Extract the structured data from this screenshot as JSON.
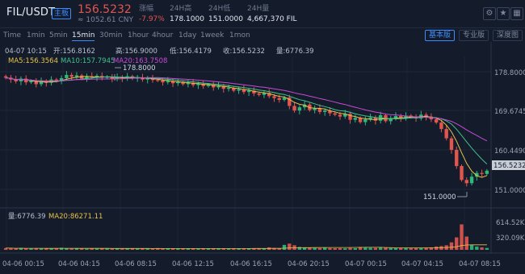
{
  "header": {
    "pair": "FIL/USDT",
    "board_tag": "主板",
    "last_price": "156.5232",
    "cny_price": "≈ 1052.61 CNY",
    "stats": [
      {
        "label": "涨幅",
        "value": "-7.97%",
        "red": true
      },
      {
        "label": "24H高",
        "value": "178.1000",
        "red": false
      },
      {
        "label": "24H低",
        "value": "151.0000",
        "red": false
      },
      {
        "label": "24H量",
        "value": "4,667,370 FIL",
        "red": false
      }
    ],
    "icons": [
      "gear-icon",
      "star-icon",
      "grid-icon"
    ]
  },
  "toolbar": {
    "intervals": [
      "Time",
      "1min",
      "5min",
      "15min",
      "30min",
      "1hour",
      "4hour",
      "1day",
      "1week",
      "1mon"
    ],
    "active_interval": "15min",
    "modes": [
      "基本版",
      "专业版",
      "深度图"
    ],
    "active_mode": "基本版"
  },
  "ohlc": {
    "date": "04-07 10:15",
    "open": "开:156.8162",
    "high": "高:156.9000",
    "low": "低:156.4179",
    "close": "收:156.5232",
    "amount": "量:6776.39"
  },
  "ma_legend": {
    "ma5": "MA5:156.3564",
    "ma10": "MA10:157.7945",
    "ma20": "MA20:163.7508"
  },
  "volume_legend": {
    "vol": "量:6776.39",
    "ma20": "MA20:86271.11"
  },
  "annotations": {
    "high_marker": "178.8000",
    "low_marker": "151.0000"
  },
  "colors": {
    "up": "#2fb87a",
    "down": "#e0564f",
    "ma5": "#e6c34a",
    "ma10": "#3fc28c",
    "ma20": "#c94bd6",
    "accent": "#3d8bfd"
  },
  "chart_data": {
    "type": "candlestick",
    "price_axis_ticks": [
      "178.8000",
      "169.6745",
      "160.4490",
      "151.0000"
    ],
    "current_price_tag": "156.5232",
    "volume_axis_ticks": [
      "614.52K",
      "320.09K"
    ],
    "time_axis_ticks": [
      "04-06 00:15",
      "04-06 04:15",
      "04-06 08:15",
      "04-06 12:15",
      "04-06 16:15",
      "04-06 20:15",
      "04-07 00:15",
      "04-07 04:15",
      "04-07 08:15"
    ],
    "price_ylim": [
      149.5,
      180.5
    ],
    "volume_ylim": [
      0,
      700
    ],
    "close_path": [
      176.6,
      176.2,
      175.8,
      176.4,
      175.6,
      175.9,
      175.2,
      175.8,
      175.5,
      176.2,
      175.9,
      176.5,
      177.2,
      176.8,
      177.1,
      176.4,
      176.9,
      176.7,
      177.0,
      176.6,
      176.8,
      176.3,
      176.7,
      176.5,
      176.9,
      176.4,
      176.6,
      176.2,
      176.5,
      176.1,
      176.0,
      175.6,
      175.9,
      175.4,
      175.7,
      175.2,
      175.5,
      175.0,
      175.3,
      174.8,
      175.1,
      174.5,
      174.8,
      174.2,
      174.4,
      173.8,
      174.1,
      173.5,
      173.8,
      173.2,
      172.9,
      173.3,
      172.6,
      172.2,
      171.8,
      172.3,
      170.5,
      169.5,
      170.2,
      170.8,
      169.6,
      170.0,
      169.2,
      169.5,
      168.9,
      168.6,
      168.2,
      168.8,
      167.5,
      167.9,
      167.0,
      167.6,
      168.0,
      167.3,
      168.5,
      167.2,
      167.8,
      168.3,
      167.9,
      168.4,
      168.1,
      167.8,
      168.6,
      168.2,
      167.6,
      166.9,
      165.5,
      163.5,
      161.0,
      157.5,
      154.5,
      153.8,
      155.2,
      156.0,
      155.8,
      156.5
    ],
    "volume_values": [
      42,
      38,
      30,
      45,
      28,
      35,
      40,
      32,
      30,
      36,
      28,
      50,
      40,
      35,
      30,
      38,
      25,
      30,
      28,
      34,
      30,
      26,
      32,
      28,
      30,
      35,
      28,
      32,
      30,
      28,
      35,
      30,
      40,
      32,
      28,
      30,
      36,
      30,
      28,
      34,
      30,
      32,
      28,
      30,
      35,
      38,
      30,
      28,
      34,
      36,
      40,
      32,
      60,
      45,
      38,
      120,
      150,
      110,
      70,
      60,
      50,
      45,
      40,
      48,
      42,
      38,
      40,
      36,
      45,
      40,
      70,
      55,
      50,
      46,
      60,
      48,
      42,
      40,
      45,
      50,
      46,
      42,
      48,
      52,
      60,
      80,
      90,
      110,
      180,
      300,
      614,
      320,
      120,
      80,
      60,
      45
    ]
  }
}
